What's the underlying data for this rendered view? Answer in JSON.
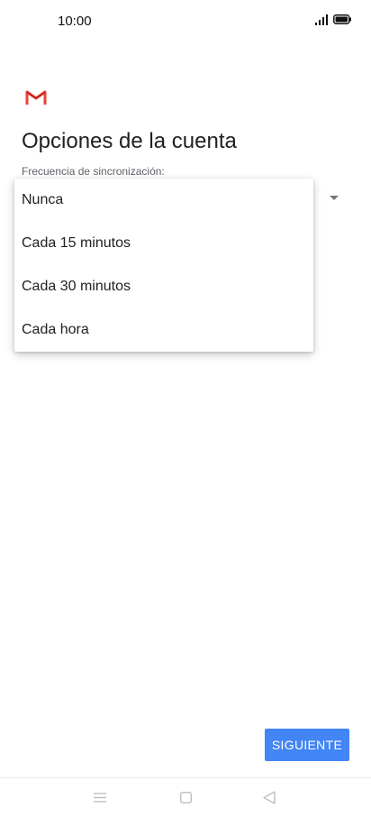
{
  "status_bar": {
    "time": "10:00",
    "icons": [
      "signal-icon",
      "battery-icon"
    ]
  },
  "app": {
    "logo": "gmail-logo",
    "brand_colors": {
      "red": "#ea4335",
      "dark_red": "#c5221f"
    }
  },
  "page": {
    "title": "Opciones de la cuenta",
    "field_label": "Frecuencia de sincronización:"
  },
  "dropdown": {
    "options": [
      "Nunca",
      "Cada 15 minutos",
      "Cada 30 minutos",
      "Cada hora"
    ]
  },
  "actions": {
    "next_label": "SIGUIENTE",
    "accent_color": "#4285f4"
  },
  "nav_bar": {
    "icons": [
      "menu-icon",
      "home-icon",
      "back-icon"
    ]
  }
}
